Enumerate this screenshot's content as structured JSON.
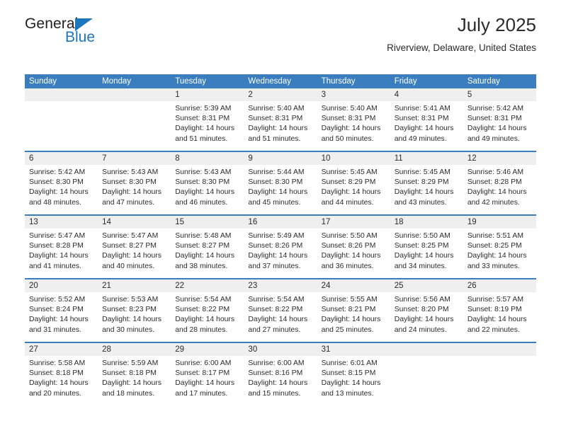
{
  "brand": {
    "name_top": "General",
    "name_bottom": "Blue",
    "accent_color": "#1b76bc"
  },
  "header": {
    "title": "July 2025",
    "subtitle": "Riverview, Delaware, United States"
  },
  "theme": {
    "header_blue": "#3a7ebf",
    "date_band": "#efefef",
    "text": "#2b2b2b"
  },
  "weekdays": [
    "Sunday",
    "Monday",
    "Tuesday",
    "Wednesday",
    "Thursday",
    "Friday",
    "Saturday"
  ],
  "weeks": [
    [
      {
        "day": "",
        "lines": []
      },
      {
        "day": "",
        "lines": []
      },
      {
        "day": "1",
        "lines": [
          "Sunrise: 5:39 AM",
          "Sunset: 8:31 PM",
          "Daylight: 14 hours",
          "and 51 minutes."
        ]
      },
      {
        "day": "2",
        "lines": [
          "Sunrise: 5:40 AM",
          "Sunset: 8:31 PM",
          "Daylight: 14 hours",
          "and 51 minutes."
        ]
      },
      {
        "day": "3",
        "lines": [
          "Sunrise: 5:40 AM",
          "Sunset: 8:31 PM",
          "Daylight: 14 hours",
          "and 50 minutes."
        ]
      },
      {
        "day": "4",
        "lines": [
          "Sunrise: 5:41 AM",
          "Sunset: 8:31 PM",
          "Daylight: 14 hours",
          "and 49 minutes."
        ]
      },
      {
        "day": "5",
        "lines": [
          "Sunrise: 5:42 AM",
          "Sunset: 8:31 PM",
          "Daylight: 14 hours",
          "and 49 minutes."
        ]
      }
    ],
    [
      {
        "day": "6",
        "lines": [
          "Sunrise: 5:42 AM",
          "Sunset: 8:30 PM",
          "Daylight: 14 hours",
          "and 48 minutes."
        ]
      },
      {
        "day": "7",
        "lines": [
          "Sunrise: 5:43 AM",
          "Sunset: 8:30 PM",
          "Daylight: 14 hours",
          "and 47 minutes."
        ]
      },
      {
        "day": "8",
        "lines": [
          "Sunrise: 5:43 AM",
          "Sunset: 8:30 PM",
          "Daylight: 14 hours",
          "and 46 minutes."
        ]
      },
      {
        "day": "9",
        "lines": [
          "Sunrise: 5:44 AM",
          "Sunset: 8:30 PM",
          "Daylight: 14 hours",
          "and 45 minutes."
        ]
      },
      {
        "day": "10",
        "lines": [
          "Sunrise: 5:45 AM",
          "Sunset: 8:29 PM",
          "Daylight: 14 hours",
          "and 44 minutes."
        ]
      },
      {
        "day": "11",
        "lines": [
          "Sunrise: 5:45 AM",
          "Sunset: 8:29 PM",
          "Daylight: 14 hours",
          "and 43 minutes."
        ]
      },
      {
        "day": "12",
        "lines": [
          "Sunrise: 5:46 AM",
          "Sunset: 8:28 PM",
          "Daylight: 14 hours",
          "and 42 minutes."
        ]
      }
    ],
    [
      {
        "day": "13",
        "lines": [
          "Sunrise: 5:47 AM",
          "Sunset: 8:28 PM",
          "Daylight: 14 hours",
          "and 41 minutes."
        ]
      },
      {
        "day": "14",
        "lines": [
          "Sunrise: 5:47 AM",
          "Sunset: 8:27 PM",
          "Daylight: 14 hours",
          "and 40 minutes."
        ]
      },
      {
        "day": "15",
        "lines": [
          "Sunrise: 5:48 AM",
          "Sunset: 8:27 PM",
          "Daylight: 14 hours",
          "and 38 minutes."
        ]
      },
      {
        "day": "16",
        "lines": [
          "Sunrise: 5:49 AM",
          "Sunset: 8:26 PM",
          "Daylight: 14 hours",
          "and 37 minutes."
        ]
      },
      {
        "day": "17",
        "lines": [
          "Sunrise: 5:50 AM",
          "Sunset: 8:26 PM",
          "Daylight: 14 hours",
          "and 36 minutes."
        ]
      },
      {
        "day": "18",
        "lines": [
          "Sunrise: 5:50 AM",
          "Sunset: 8:25 PM",
          "Daylight: 14 hours",
          "and 34 minutes."
        ]
      },
      {
        "day": "19",
        "lines": [
          "Sunrise: 5:51 AM",
          "Sunset: 8:25 PM",
          "Daylight: 14 hours",
          "and 33 minutes."
        ]
      }
    ],
    [
      {
        "day": "20",
        "lines": [
          "Sunrise: 5:52 AM",
          "Sunset: 8:24 PM",
          "Daylight: 14 hours",
          "and 31 minutes."
        ]
      },
      {
        "day": "21",
        "lines": [
          "Sunrise: 5:53 AM",
          "Sunset: 8:23 PM",
          "Daylight: 14 hours",
          "and 30 minutes."
        ]
      },
      {
        "day": "22",
        "lines": [
          "Sunrise: 5:54 AM",
          "Sunset: 8:22 PM",
          "Daylight: 14 hours",
          "and 28 minutes."
        ]
      },
      {
        "day": "23",
        "lines": [
          "Sunrise: 5:54 AM",
          "Sunset: 8:22 PM",
          "Daylight: 14 hours",
          "and 27 minutes."
        ]
      },
      {
        "day": "24",
        "lines": [
          "Sunrise: 5:55 AM",
          "Sunset: 8:21 PM",
          "Daylight: 14 hours",
          "and 25 minutes."
        ]
      },
      {
        "day": "25",
        "lines": [
          "Sunrise: 5:56 AM",
          "Sunset: 8:20 PM",
          "Daylight: 14 hours",
          "and 24 minutes."
        ]
      },
      {
        "day": "26",
        "lines": [
          "Sunrise: 5:57 AM",
          "Sunset: 8:19 PM",
          "Daylight: 14 hours",
          "and 22 minutes."
        ]
      }
    ],
    [
      {
        "day": "27",
        "lines": [
          "Sunrise: 5:58 AM",
          "Sunset: 8:18 PM",
          "Daylight: 14 hours",
          "and 20 minutes."
        ]
      },
      {
        "day": "28",
        "lines": [
          "Sunrise: 5:59 AM",
          "Sunset: 8:18 PM",
          "Daylight: 14 hours",
          "and 18 minutes."
        ]
      },
      {
        "day": "29",
        "lines": [
          "Sunrise: 6:00 AM",
          "Sunset: 8:17 PM",
          "Daylight: 14 hours",
          "and 17 minutes."
        ]
      },
      {
        "day": "30",
        "lines": [
          "Sunrise: 6:00 AM",
          "Sunset: 8:16 PM",
          "Daylight: 14 hours",
          "and 15 minutes."
        ]
      },
      {
        "day": "31",
        "lines": [
          "Sunrise: 6:01 AM",
          "Sunset: 8:15 PM",
          "Daylight: 14 hours",
          "and 13 minutes."
        ]
      },
      {
        "day": "",
        "lines": []
      },
      {
        "day": "",
        "lines": []
      }
    ]
  ]
}
